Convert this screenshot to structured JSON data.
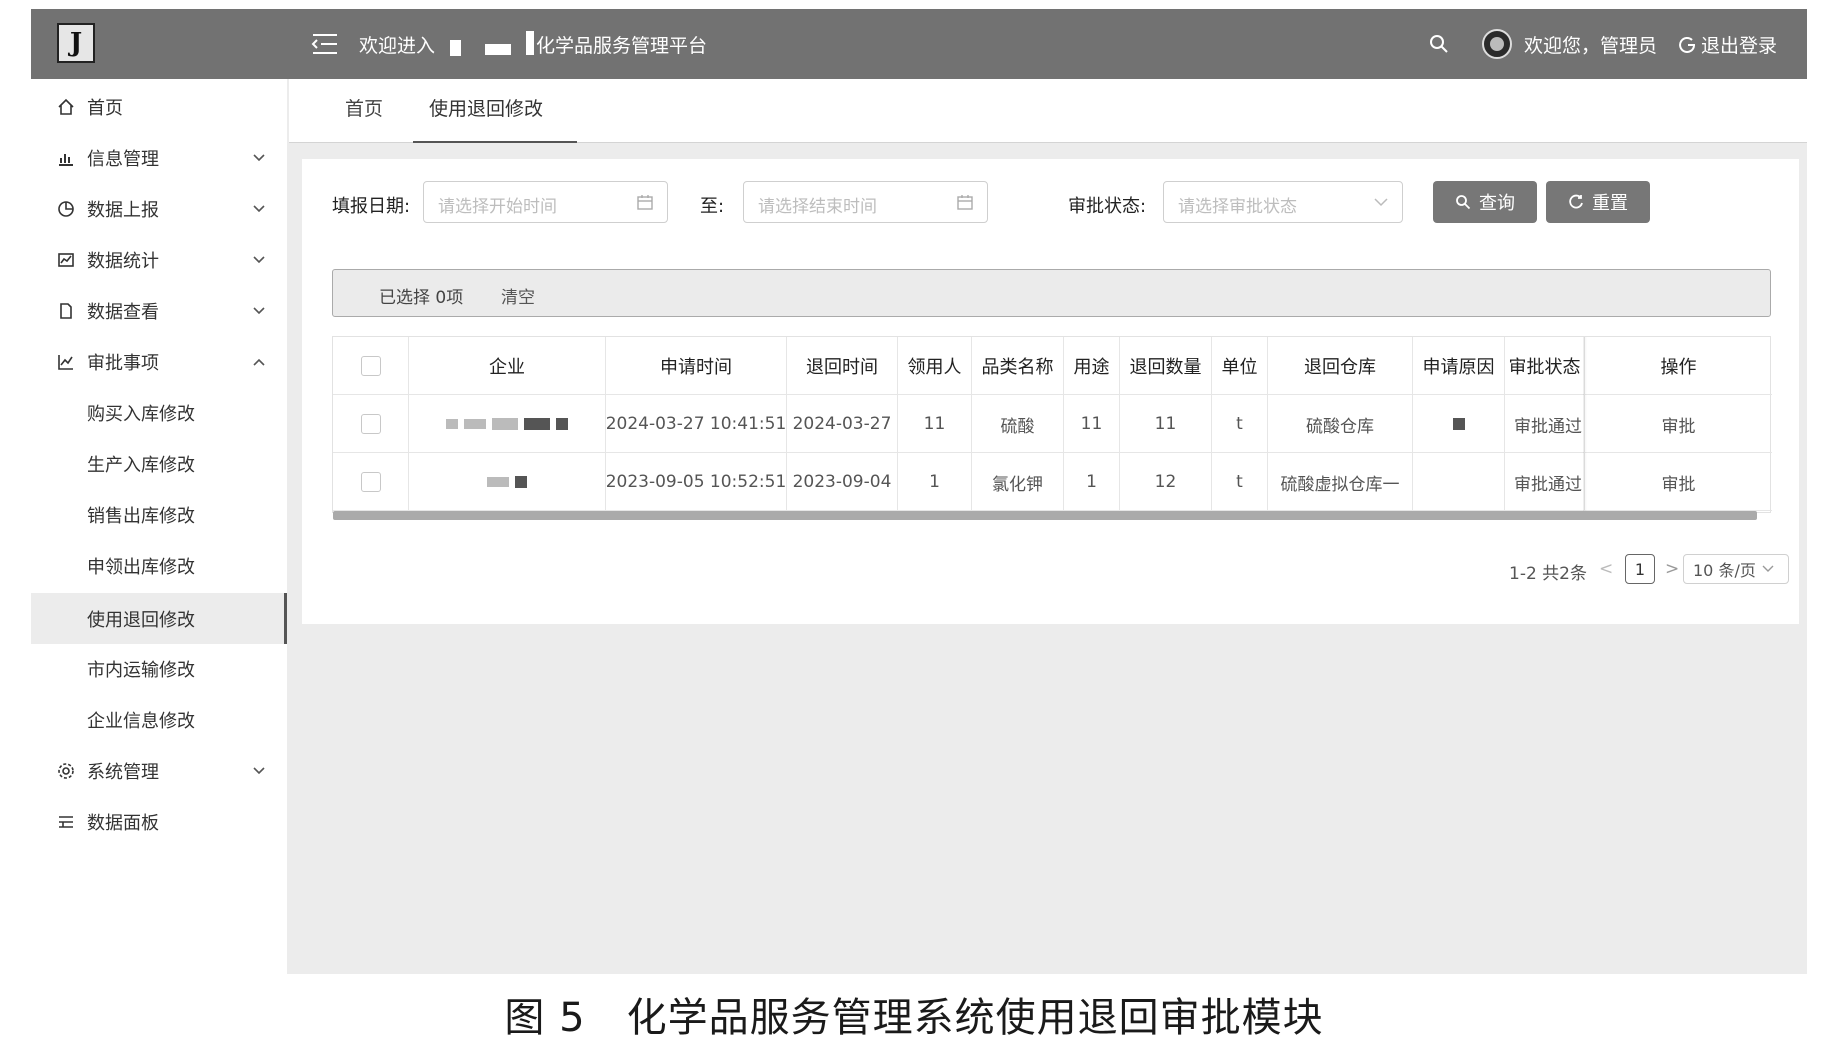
{
  "header": {
    "logo_letter": "J",
    "welcome_into": "欢迎进入",
    "platform_name": "化学品服务管理平台",
    "greeting": "欢迎您，管理员",
    "logout_label": "退出登录",
    "icons": [
      "menu-fold-icon",
      "search-icon",
      "avatar",
      "logout-icon"
    ]
  },
  "sidebar": {
    "items": [
      {
        "label": "首页",
        "icon": "home-icon"
      },
      {
        "label": "信息管理",
        "icon": "chart-icon",
        "expanded": false
      },
      {
        "label": "数据上报",
        "icon": "pie-icon",
        "expanded": false
      },
      {
        "label": "数据统计",
        "icon": "statistics-icon",
        "expanded": false
      },
      {
        "label": "数据查看",
        "icon": "file-icon",
        "expanded": false
      },
      {
        "label": "审批事项",
        "icon": "line-chart-icon",
        "expanded": true
      },
      {
        "label": "购买入库修改",
        "sub": true
      },
      {
        "label": "生产入库修改",
        "sub": true
      },
      {
        "label": "销售出库修改",
        "sub": true
      },
      {
        "label": "申领出库修改",
        "sub": true
      },
      {
        "label": "使用退回修改",
        "sub": true,
        "active": true
      },
      {
        "label": "市内运输修改",
        "sub": true
      },
      {
        "label": "企业信息修改",
        "sub": true
      },
      {
        "label": "系统管理",
        "icon": "gear-icon",
        "expanded": false
      },
      {
        "label": "数据面板",
        "icon": "panel-icon"
      }
    ]
  },
  "tabs": [
    {
      "label": "首页"
    },
    {
      "label": "使用退回修改",
      "active": true
    }
  ],
  "filters": {
    "date_label": "填报日期:",
    "start_placeholder": "请选择开始时间",
    "to_label": "至:",
    "end_placeholder": "请选择结束时间",
    "status_label": "审批状态:",
    "status_placeholder": "请选择审批状态",
    "query_button": "查询",
    "reset_button": "重置"
  },
  "selection": {
    "selected_text": "已选择 0项",
    "clear_label": "清空"
  },
  "table": {
    "columns": [
      "企业",
      "申请时间",
      "退回时间",
      "领用人",
      "品类名称",
      "用途",
      "退回数量",
      "单位",
      "退回仓库",
      "申请原因",
      "审批状态",
      "操作"
    ],
    "rows": [
      {
        "company": "",
        "apply_time": "2024-03-27 10:41:51",
        "return_time": "2024-03-27",
        "receiver": "11",
        "category": "硫酸",
        "usage": "11",
        "quantity": "11",
        "unit": "t",
        "warehouse": "硫酸仓库",
        "reason": "",
        "status": "审批通过",
        "action": "审批"
      },
      {
        "company": "",
        "apply_time": "2023-09-05 10:52:51",
        "return_time": "2023-09-04",
        "receiver": "1",
        "category": "氯化钾",
        "usage": "1",
        "quantity": "12",
        "unit": "t",
        "warehouse": "硫酸虚拟仓库一",
        "reason": "",
        "status": "审批通过",
        "action": "审批"
      }
    ]
  },
  "pagination": {
    "total_text": "1-2 共2条",
    "current_page": "1",
    "page_size": "10 条/页"
  },
  "caption": "图 5　化学品服务管理系统使用退回审批模块",
  "colors": {
    "header_bg": "#727272",
    "button_bg": "#777777",
    "page_bg": "#ececec"
  }
}
